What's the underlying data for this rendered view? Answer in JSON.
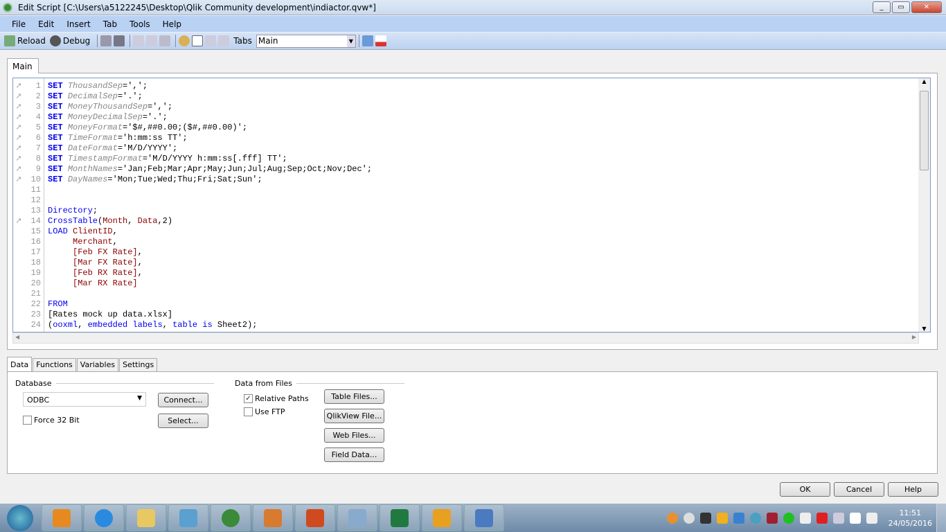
{
  "window": {
    "title": "Edit Script [C:\\Users\\a5122245\\Desktop\\Qlik Community development\\indiactor.qvw*]"
  },
  "menu": [
    "File",
    "Edit",
    "Insert",
    "Tab",
    "Tools",
    "Help"
  ],
  "toolbar": {
    "reload": "Reload",
    "debug": "Debug",
    "tabs_label": "Tabs",
    "tabs_value": "Main"
  },
  "script_tab": "Main",
  "code": [
    {
      "n": "1",
      "arrow": true,
      "t": [
        [
          "kw",
          "SET "
        ],
        [
          "var",
          "ThousandSep"
        ],
        [
          "str",
          "=',';"
        ]
      ]
    },
    {
      "n": "2",
      "arrow": true,
      "t": [
        [
          "kw",
          "SET "
        ],
        [
          "var",
          "DecimalSep"
        ],
        [
          "str",
          "='.';"
        ]
      ]
    },
    {
      "n": "3",
      "arrow": true,
      "t": [
        [
          "kw",
          "SET "
        ],
        [
          "var",
          "MoneyThousandSep"
        ],
        [
          "str",
          "=',';"
        ]
      ]
    },
    {
      "n": "4",
      "arrow": true,
      "t": [
        [
          "kw",
          "SET "
        ],
        [
          "var",
          "MoneyDecimalSep"
        ],
        [
          "str",
          "='.';"
        ]
      ]
    },
    {
      "n": "5",
      "arrow": true,
      "t": [
        [
          "kw",
          "SET "
        ],
        [
          "var",
          "MoneyFormat"
        ],
        [
          "str",
          "='$#,##0.00;($#,##0.00)';"
        ]
      ]
    },
    {
      "n": "6",
      "arrow": true,
      "t": [
        [
          "kw",
          "SET "
        ],
        [
          "var",
          "TimeFormat"
        ],
        [
          "str",
          "='h:mm:ss TT';"
        ]
      ]
    },
    {
      "n": "7",
      "arrow": true,
      "t": [
        [
          "kw",
          "SET "
        ],
        [
          "var",
          "DateFormat"
        ],
        [
          "str",
          "='M/D/YYYY';"
        ]
      ]
    },
    {
      "n": "8",
      "arrow": true,
      "t": [
        [
          "kw",
          "SET "
        ],
        [
          "var",
          "TimestampFormat"
        ],
        [
          "str",
          "='M/D/YYYY h:mm:ss[.fff] TT';"
        ]
      ]
    },
    {
      "n": "9",
      "arrow": true,
      "t": [
        [
          "kw",
          "SET "
        ],
        [
          "var",
          "MonthNames"
        ],
        [
          "str",
          "='Jan;Feb;Mar;Apr;May;Jun;Jul;Aug;Sep;Oct;Nov;Dec';"
        ]
      ]
    },
    {
      "n": "10",
      "arrow": true,
      "t": [
        [
          "kw",
          "SET "
        ],
        [
          "var",
          "DayNames"
        ],
        [
          "str",
          "='Mon;Tue;Wed;Thu;Fri;Sat;Sun';"
        ]
      ]
    },
    {
      "n": "11",
      "t": []
    },
    {
      "n": "12",
      "t": []
    },
    {
      "n": "13",
      "t": [
        [
          "fn",
          "Directory"
        ],
        [
          "str",
          ";"
        ]
      ]
    },
    {
      "n": "14",
      "arrow": true,
      "t": [
        [
          "fn",
          "CrossTable"
        ],
        [
          "str",
          "("
        ],
        [
          "fld",
          "Month"
        ],
        [
          "str",
          ", "
        ],
        [
          "fld",
          "Data"
        ],
        [
          "str",
          ",2)"
        ]
      ]
    },
    {
      "n": "15",
      "t": [
        [
          "fn",
          "LOAD "
        ],
        [
          "fld",
          "ClientID"
        ],
        [
          "str",
          ","
        ]
      ]
    },
    {
      "n": "16",
      "t": [
        [
          "str",
          "     "
        ],
        [
          "fld",
          "Merchant"
        ],
        [
          "str",
          ","
        ]
      ]
    },
    {
      "n": "17",
      "t": [
        [
          "str",
          "     "
        ],
        [
          "fld",
          "[Feb FX Rate]"
        ],
        [
          "str",
          ","
        ]
      ]
    },
    {
      "n": "18",
      "t": [
        [
          "str",
          "     "
        ],
        [
          "fld",
          "[Mar FX Rate]"
        ],
        [
          "str",
          ","
        ]
      ]
    },
    {
      "n": "19",
      "t": [
        [
          "str",
          "     "
        ],
        [
          "fld",
          "[Feb RX Rate]"
        ],
        [
          "str",
          ","
        ]
      ]
    },
    {
      "n": "20",
      "t": [
        [
          "str",
          "     "
        ],
        [
          "fld",
          "[Mar RX Rate]"
        ]
      ]
    },
    {
      "n": "21",
      "t": []
    },
    {
      "n": "22",
      "t": [
        [
          "fn",
          "FROM"
        ]
      ]
    },
    {
      "n": "23",
      "t": [
        [
          "str",
          "[Rates mock up data.xlsx]"
        ]
      ]
    },
    {
      "n": "24",
      "t": [
        [
          "str",
          "("
        ],
        [
          "fn",
          "ooxml"
        ],
        [
          "str",
          ", "
        ],
        [
          "fn",
          "embedded labels"
        ],
        [
          "str",
          ", "
        ],
        [
          "fn",
          "table is "
        ],
        [
          "str",
          "Sheet2);"
        ]
      ]
    }
  ],
  "bottom_tabs": [
    "Data",
    "Functions",
    "Variables",
    "Settings"
  ],
  "data_panel": {
    "database_label": "Database",
    "database_value": "ODBC",
    "connect": "Connect...",
    "select": "Select...",
    "force32": "Force 32 Bit",
    "files_label": "Data from Files",
    "relative_paths": "Relative Paths",
    "use_ftp": "Use FTP",
    "table_files": "Table Files...",
    "qlikview_file": "QlikView File...",
    "web_files": "Web Files...",
    "field_data": "Field Data..."
  },
  "dialog": {
    "ok": "OK",
    "cancel": "Cancel",
    "help": "Help"
  },
  "clock": {
    "time": "11:51",
    "date": "24/05/2016"
  }
}
